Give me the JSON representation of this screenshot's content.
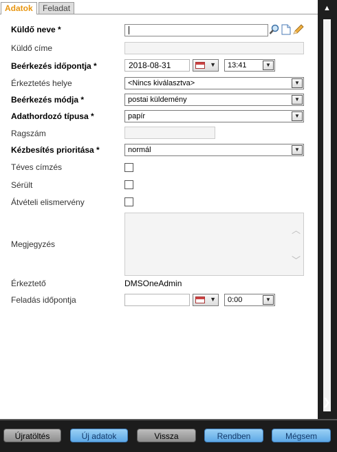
{
  "tabs": [
    {
      "label": "Adatok"
    },
    {
      "label": "Feladat"
    }
  ],
  "fields": {
    "kuldo_neve": {
      "label": "Küldő neve *",
      "value": ""
    },
    "kuldo_cime": {
      "label": "Küldő címe",
      "value": ""
    },
    "beerkezes_idopontja": {
      "label": "Beérkezés időpontja *",
      "date": "2018-08-31",
      "time": "13:41"
    },
    "erkeztetes_helye": {
      "label": "Érkeztetés helye",
      "value": "<Nincs kiválasztva>"
    },
    "beerkezes_modja": {
      "label": "Beérkezés módja *",
      "value": "postai küldemény"
    },
    "adathordozo_tipusa": {
      "label": "Adathordozó típusa *",
      "value": "papír"
    },
    "ragszam": {
      "label": "Ragszám",
      "value": ""
    },
    "kezbesites_prioritasa": {
      "label": "Kézbesítés prioritása *",
      "value": "normál"
    },
    "teves_cimzes": {
      "label": "Téves címzés"
    },
    "serult": {
      "label": "Sérült"
    },
    "atveteli_elismerveny": {
      "label": "Átvételi elismervény"
    },
    "megjegyzes": {
      "label": "Megjegyzés",
      "value": ""
    },
    "erkezteto": {
      "label": "Érkeztető",
      "value": "DMSOneAdmin"
    },
    "feladas_idopontja": {
      "label": "Feladás időpontja",
      "date": "",
      "time": "0:00"
    }
  },
  "buttons": {
    "ujratoltes": "Újratöltés",
    "uj_adatok": "Új adatok",
    "vissza": "Vissza",
    "rendben": "Rendben",
    "megsem": "Mégsem"
  },
  "icons": {
    "search": "search-icon",
    "new_doc": "document-icon",
    "edit": "pencil-icon",
    "calendar": "calendar-icon",
    "dropdown": "chevron-down-icon"
  },
  "colors": {
    "active_tab": "#e8950f",
    "footer_bg": "#1c1c1c",
    "blue_button": "#5ea9e6",
    "gray_button": "#8e8e8e"
  }
}
